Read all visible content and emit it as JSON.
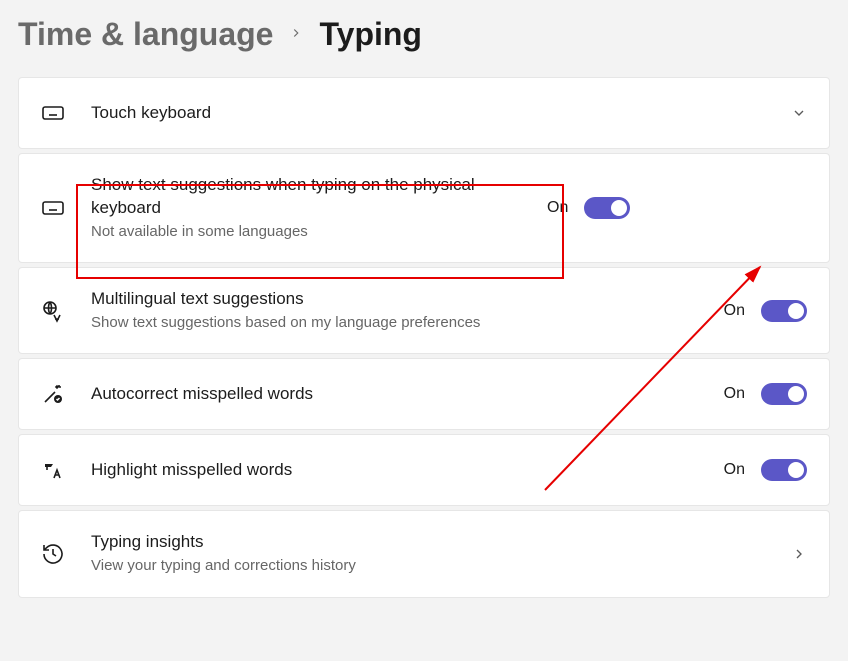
{
  "breadcrumb": {
    "parent": "Time & language",
    "current": "Typing"
  },
  "items": [
    {
      "icon": "keyboard",
      "title": "Touch keyboard",
      "subtitle": "",
      "control": "expand"
    },
    {
      "icon": "keyboard",
      "title": "Show text suggestions when typing on the physical keyboard",
      "subtitle": "Not available in some languages",
      "control": "toggle",
      "state": "On"
    },
    {
      "icon": "globe-translate",
      "title": "Multilingual text suggestions",
      "subtitle": "Show text suggestions based on my language preferences",
      "control": "toggle",
      "state": "On"
    },
    {
      "icon": "wand-check",
      "title": "Autocorrect misspelled words",
      "subtitle": "",
      "control": "toggle",
      "state": "On"
    },
    {
      "icon": "highlight-letter",
      "title": "Highlight misspelled words",
      "subtitle": "",
      "control": "toggle",
      "state": "On"
    },
    {
      "icon": "history",
      "title": "Typing insights",
      "subtitle": "View your typing and corrections history",
      "control": "navigate"
    }
  ],
  "annotation": {
    "highlight_index": 1,
    "arrow_to": "toggle"
  }
}
